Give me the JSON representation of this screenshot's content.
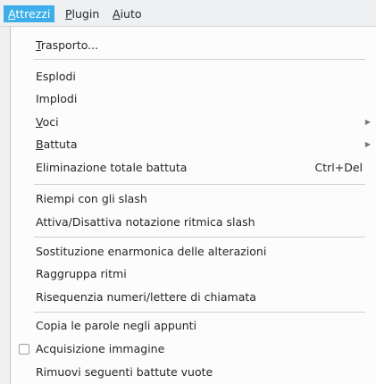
{
  "menubar": {
    "items": [
      {
        "first": "A",
        "rest": "ttrezzi"
      },
      {
        "first": "P",
        "rest": "lugin"
      },
      {
        "first": "A",
        "rest": "iuto"
      }
    ]
  },
  "menu": {
    "items": [
      {
        "first": "T",
        "rest": "rasporto..."
      },
      {
        "label": "Esplodi"
      },
      {
        "label": "Implodi"
      },
      {
        "first": "V",
        "rest": "oci"
      },
      {
        "first": "B",
        "rest": "attuta"
      },
      {
        "label": "Eliminazione totale battuta",
        "shortcut": "Ctrl+Del"
      },
      {
        "label": "Riempi con gli slash"
      },
      {
        "label": "Attiva/Disattiva notazione ritmica slash"
      },
      {
        "label": "Sostituzione enarmonica delle alterazioni"
      },
      {
        "label": "Raggruppa ritmi"
      },
      {
        "label": "Risequenzia numeri/lettere di chiamata"
      },
      {
        "label": "Copia le parole negli appunti"
      },
      {
        "label": "Acquisizione immagine"
      },
      {
        "label": "Rimuovi seguenti battute vuote"
      }
    ]
  },
  "colors": {
    "accent": "#3daee9",
    "menu_bg": "#fcfcfc",
    "menubar_bg": "#eff0f1"
  }
}
